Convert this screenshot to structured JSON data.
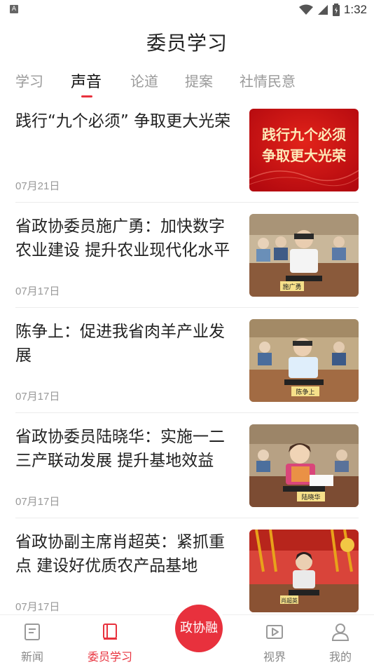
{
  "status_bar": {
    "app_icon": "A",
    "time": "1:32",
    "icons": [
      "wifi-icon",
      "signal-icon",
      "battery-icon"
    ]
  },
  "header": {
    "title": "委员学习"
  },
  "tabs": [
    {
      "label": "学习",
      "active": false
    },
    {
      "label": "声音",
      "active": true
    },
    {
      "label": "论道",
      "active": false
    },
    {
      "label": "提案",
      "active": false
    },
    {
      "label": "社情民意",
      "active": false
    }
  ],
  "news": [
    {
      "title": "践行“九个必须” 争取更大光荣",
      "date": "07月21日",
      "thumb_text": "践行九个必须\n争取更大光荣"
    },
    {
      "title": "省政协委员施广勇：加快数字农业建设 提升农业现代化水平",
      "date": "07月17日",
      "thumb_nameplate": "施广勇"
    },
    {
      "title": "陈争上：促进我省肉羊产业发展",
      "date": "07月17日",
      "thumb_nameplate": "陈争上"
    },
    {
      "title": "省政协委员陆晓华：实施一二三产联动发展 提升基地效益",
      "date": "07月17日",
      "thumb_nameplate": "陆晓华"
    },
    {
      "title": "省政协副主席肖超英：紧抓重点 建设好优质农产品基地",
      "date": "07月17日",
      "thumb_nameplate": "肖超英"
    }
  ],
  "bottom_nav": {
    "items": [
      {
        "label": "新闻",
        "icon": "news-icon",
        "active": false
      },
      {
        "label": "委员学习",
        "icon": "book-icon",
        "active": true
      },
      {
        "label": "视界",
        "icon": "video-icon",
        "active": false
      },
      {
        "label": "我的",
        "icon": "profile-icon",
        "active": false
      }
    ],
    "center_label": "政协融"
  },
  "colors": {
    "accent": "#e8313d",
    "text": "#222222",
    "muted": "#999999"
  }
}
